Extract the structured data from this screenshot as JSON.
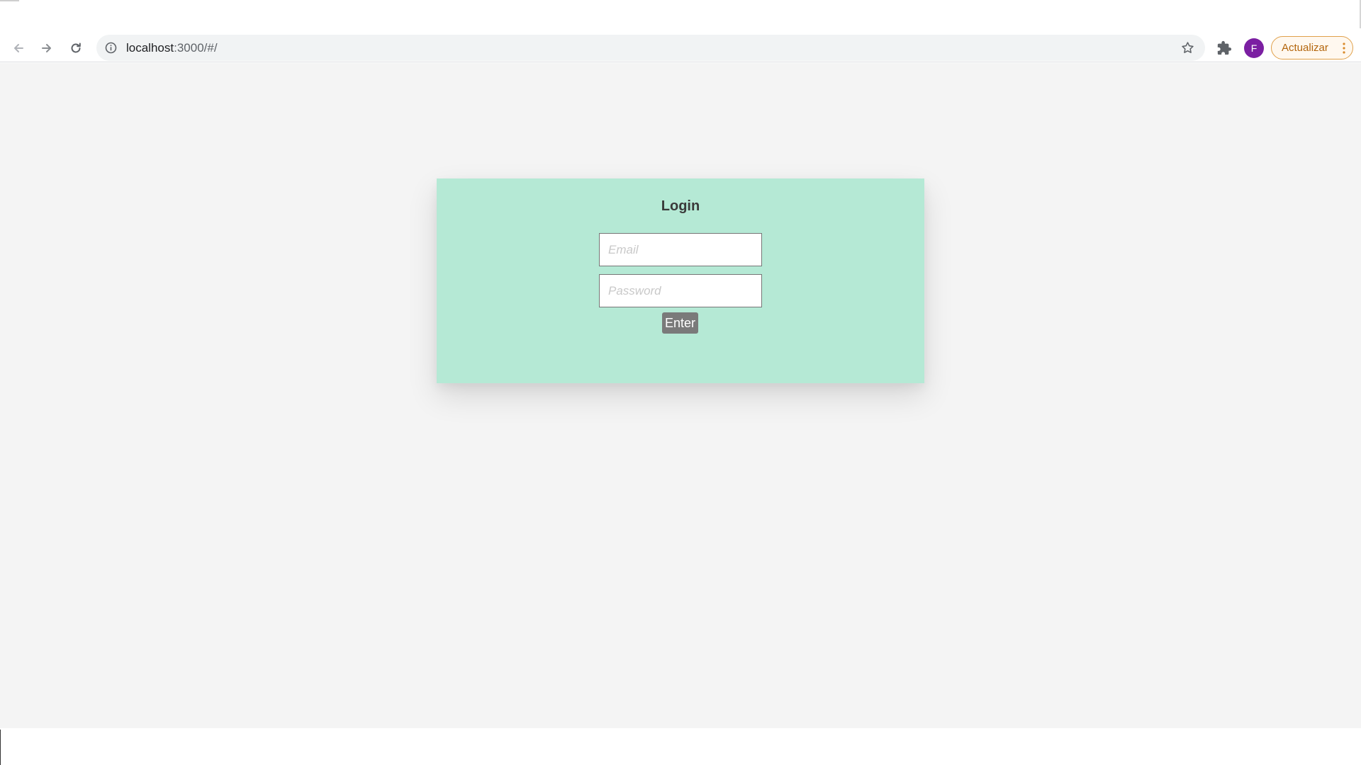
{
  "browser": {
    "url_host": "localhost",
    "url_rest": ":3000/#/",
    "profile_initial": "F",
    "update_label": "Actualizar",
    "icons": [
      "back-arrow-icon",
      "forward-arrow-icon",
      "reload-icon",
      "site-info-icon",
      "bookmark-star-icon",
      "extensions-puzzle-icon",
      "more-vert-icon"
    ],
    "colors": {
      "avatar": "#7b1fa2",
      "update_accent": "#b3650b"
    }
  },
  "login": {
    "title": "Login",
    "email_placeholder": "Email",
    "password_placeholder": "Password",
    "submit_label": "Enter",
    "colors": {
      "card_background": "#b5e9d5",
      "page_background": "#f4f4f4",
      "button_background": "#7a7a7a"
    }
  }
}
